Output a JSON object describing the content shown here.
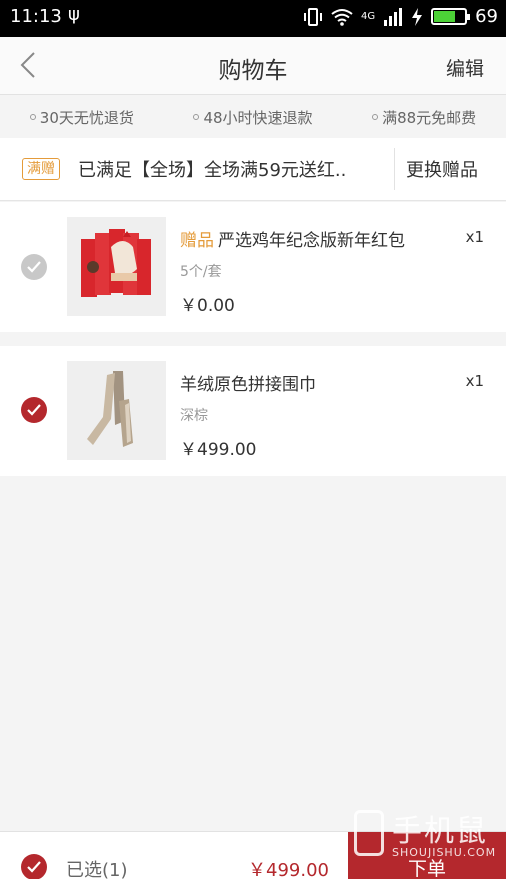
{
  "status_bar": {
    "time": "11:13",
    "usb_glyph": "ψ",
    "network": "4G",
    "battery_level": 69,
    "battery_text": "69"
  },
  "nav": {
    "back_icon": "chevron-left-icon",
    "title": "购物车",
    "edit_label": "编辑"
  },
  "promises": [
    "30天无忧退货",
    "48小时快速退款",
    "满88元免邮费"
  ],
  "gift_promo": {
    "tag": "满赠",
    "text": "已满足【全场】全场满59元送红..",
    "change_label": "更换赠品"
  },
  "items": [
    {
      "badge": "赠品",
      "name": "严选鸡年纪念版新年红包",
      "spec": "5个/套",
      "price": "￥0.00",
      "qty": "x1",
      "checked": false,
      "disabled": true
    },
    {
      "badge": "",
      "name": "羊绒原色拼接围巾",
      "spec": "深棕",
      "price": "￥499.00",
      "qty": "x1",
      "checked": true,
      "disabled": false
    }
  ],
  "bottom": {
    "selected_label": "已选(1)",
    "total": "￥499.00",
    "order_label": "下单"
  },
  "watermark": {
    "cn": "手机鼠",
    "en": "SHOUJISHU.COM"
  },
  "colors": {
    "accent": "#b4282d",
    "gift": "#e49b3a",
    "background": "#f4f4f4"
  }
}
